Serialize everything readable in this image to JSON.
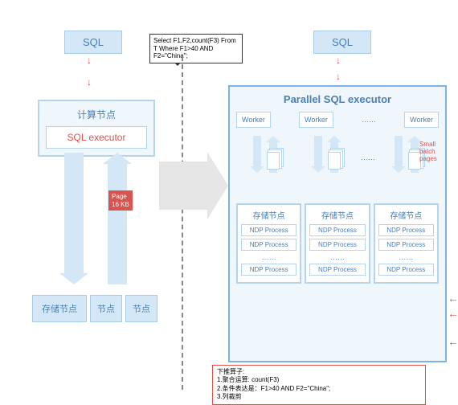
{
  "left": {
    "sql": "SQL",
    "compute_title": "计算节点",
    "sql_executor": "SQL executor",
    "page_label": "Page 16 KB",
    "storage1": "存储节点",
    "storage2": "节点",
    "storage3": "节点"
  },
  "speech": "Select F1,F2,count(F3) From T Where F1>40 AND F2=\"China\";",
  "right": {
    "sql": "SQL",
    "parallel_title": "Parallel SQL executor",
    "workers": [
      "Worker",
      "Worker",
      "Worker"
    ],
    "worker_dots": "……",
    "small_batch": "Small batch pages",
    "arrow_dots": "……",
    "storage_cols": [
      {
        "title": "存储节点",
        "procs": [
          "NDP Process",
          "NDP Process",
          "NDP Process"
        ],
        "dots": "……"
      },
      {
        "title": "存储节点",
        "procs": [
          "NDP Process",
          "NDP Process",
          "NDP Process"
        ],
        "dots": "……"
      },
      {
        "title": "存储节点",
        "procs": [
          "NDP Process",
          "NDP Process",
          "NDP Process"
        ],
        "dots": "……"
      }
    ]
  },
  "pushdown": {
    "title": "下推算子:",
    "line1": "1.聚合运算: count(F3)",
    "line2": "2.条件表达是：F1>40 AND F2=\"China\";",
    "line3": "3.列裁剪"
  }
}
